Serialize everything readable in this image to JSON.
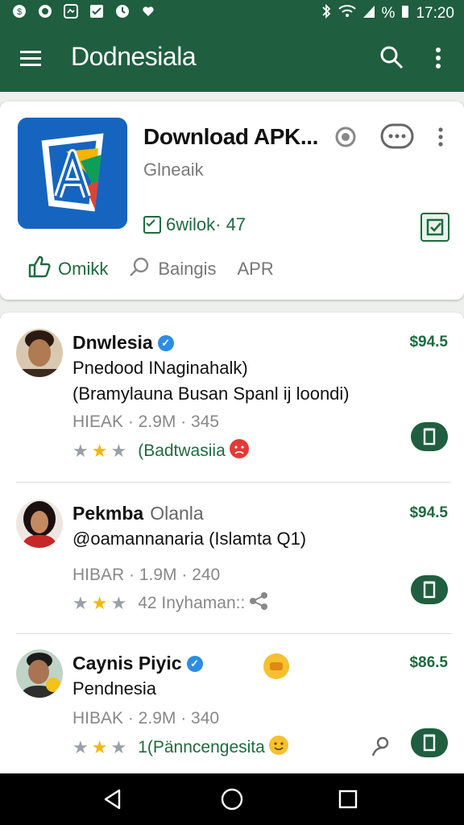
{
  "status_bar": {
    "time": "17:20",
    "percent": "%"
  },
  "app_bar": {
    "title": "Dodnesiala"
  },
  "app_card": {
    "name": "Download APK...",
    "subtitle": "Glneaik",
    "count": "6wilok· 47",
    "actions": [
      {
        "label": "Omikk"
      },
      {
        "label": "Baingis"
      },
      {
        "label": "APR"
      }
    ]
  },
  "items": [
    {
      "name": "Dnwlesia",
      "verified": true,
      "line2": "Pnedood INaginahalk)",
      "line3": "(Bramylauna Busan Spanl ij loondi)",
      "meta": "HIEAK · 2.9M · 345",
      "stars": 3,
      "tag": "(Badtwasiia",
      "price": "$94.5"
    },
    {
      "name": "Pekmba",
      "name_suffix": "Olanla",
      "verified": false,
      "line2": "@oamannanaria (Islamta Q1)",
      "meta": "HIBAR · 1.9M · 240",
      "stars": 3,
      "tag": "42 Inyhaman::",
      "price": "$94.5"
    },
    {
      "name": "Caynis Piyic",
      "verified": true,
      "line2": "Pendnesia",
      "meta": "HIBAK · 2.9M · 340",
      "stars": 3,
      "tag": "1(Pänncengesita",
      "price": "$86.5"
    }
  ],
  "colors": {
    "primary": "#1f5e3f",
    "accent": "#1f6a3f",
    "star": "#f2b705",
    "verified": "#2b8de3"
  }
}
